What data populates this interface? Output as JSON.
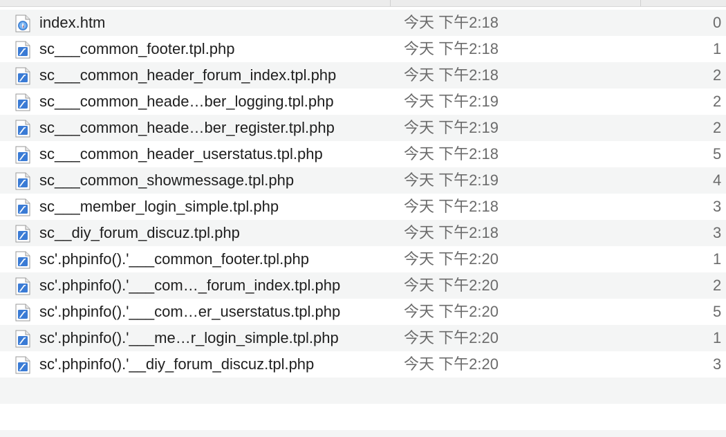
{
  "colors": {
    "row_alt": "#f4f5f5",
    "row": "#ffffff",
    "name_text": "#1f1f1f",
    "meta_text": "#6b6b6b",
    "icon_blue": "#3a7bd5"
  },
  "files": [
    {
      "name": "index.htm",
      "date": "今天 下午2:18",
      "size": "0",
      "icon": "safari-html-icon"
    },
    {
      "name": "sc___common_footer.tpl.php",
      "date": "今天 下午2:18",
      "size": "1",
      "icon": "php-script-icon"
    },
    {
      "name": "sc___common_header_forum_index.tpl.php",
      "date": "今天 下午2:18",
      "size": "2",
      "icon": "php-script-icon"
    },
    {
      "name": "sc___common_heade…ber_logging.tpl.php",
      "date": "今天 下午2:19",
      "size": "2",
      "icon": "php-script-icon"
    },
    {
      "name": "sc___common_heade…ber_register.tpl.php",
      "date": "今天 下午2:19",
      "size": "2",
      "icon": "php-script-icon"
    },
    {
      "name": "sc___common_header_userstatus.tpl.php",
      "date": "今天 下午2:18",
      "size": "5",
      "icon": "php-script-icon"
    },
    {
      "name": "sc___common_showmessage.tpl.php",
      "date": "今天 下午2:19",
      "size": "4",
      "icon": "php-script-icon"
    },
    {
      "name": "sc___member_login_simple.tpl.php",
      "date": "今天 下午2:18",
      "size": "3",
      "icon": "php-script-icon"
    },
    {
      "name": "sc__diy_forum_discuz.tpl.php",
      "date": "今天 下午2:18",
      "size": "3",
      "icon": "php-script-icon"
    },
    {
      "name": "sc'.phpinfo().'___common_footer.tpl.php",
      "date": "今天 下午2:20",
      "size": "1",
      "icon": "php-script-icon"
    },
    {
      "name": "sc'.phpinfo().'___com…_forum_index.tpl.php",
      "date": "今天 下午2:20",
      "size": "2",
      "icon": "php-script-icon"
    },
    {
      "name": "sc'.phpinfo().'___com…er_userstatus.tpl.php",
      "date": "今天 下午2:20",
      "size": "5",
      "icon": "php-script-icon"
    },
    {
      "name": "sc'.phpinfo().'___me…r_login_simple.tpl.php",
      "date": "今天 下午2:20",
      "size": "1",
      "icon": "php-script-icon"
    },
    {
      "name": "sc'.phpinfo().'__diy_forum_discuz.tpl.php",
      "date": "今天 下午2:20",
      "size": "3",
      "icon": "php-script-icon"
    }
  ]
}
